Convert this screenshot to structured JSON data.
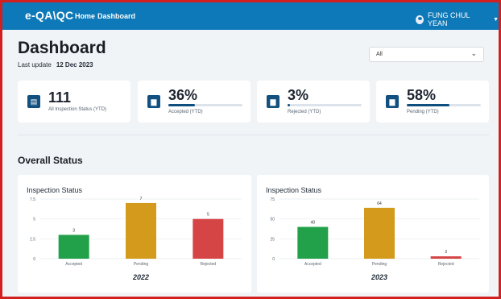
{
  "app": {
    "name": "e-QA\\QC"
  },
  "nav": {
    "home": "Home",
    "dashboard": "Dashboard"
  },
  "user": {
    "name": "FUNG CHUL YEAN"
  },
  "header": {
    "title": "Dashboard",
    "last_update_label": "Last update",
    "last_update_value": "12 Dec 2023"
  },
  "filter": {
    "value": "All"
  },
  "kpis": [
    {
      "value": "111",
      "label": "All Inspection Status (YTD)"
    },
    {
      "value": "36%",
      "label": "Accepted (YTD)",
      "fraction": 0.36
    },
    {
      "value": "3%",
      "label": "Rejected (YTD)",
      "fraction": 0.03
    },
    {
      "value": "58%",
      "label": "Pending (YTD)",
      "fraction": 0.58
    }
  ],
  "section": {
    "title": "Overall Status"
  },
  "colors": {
    "accepted": "#23a14a",
    "pending": "#d39a1c",
    "rejected": "#d64545",
    "navbar": "#0e79b8"
  },
  "chart_data": [
    {
      "type": "bar",
      "title": "Inspection Status",
      "categories": [
        "Accepted",
        "Pending",
        "Rejected"
      ],
      "values": [
        3,
        7,
        5
      ],
      "data_labels": [
        "3",
        "7",
        "5"
      ],
      "ylim": [
        0,
        7.5
      ],
      "yticks": [
        0,
        2.5,
        5,
        7.5
      ],
      "ytick_labels": [
        "0",
        "2.5",
        "5",
        "7.5"
      ],
      "xlabel": "2022",
      "grid": true
    },
    {
      "type": "bar",
      "title": "Inspection Status",
      "categories": [
        "Accepted",
        "Pending",
        "Rejected"
      ],
      "values": [
        40,
        64,
        3
      ],
      "data_labels": [
        "40",
        "64",
        "3"
      ],
      "ylim": [
        0,
        75
      ],
      "yticks": [
        0,
        25,
        50,
        75
      ],
      "ytick_labels": [
        "0",
        "25",
        "50",
        "75"
      ],
      "xlabel": "2023",
      "grid": true
    }
  ]
}
